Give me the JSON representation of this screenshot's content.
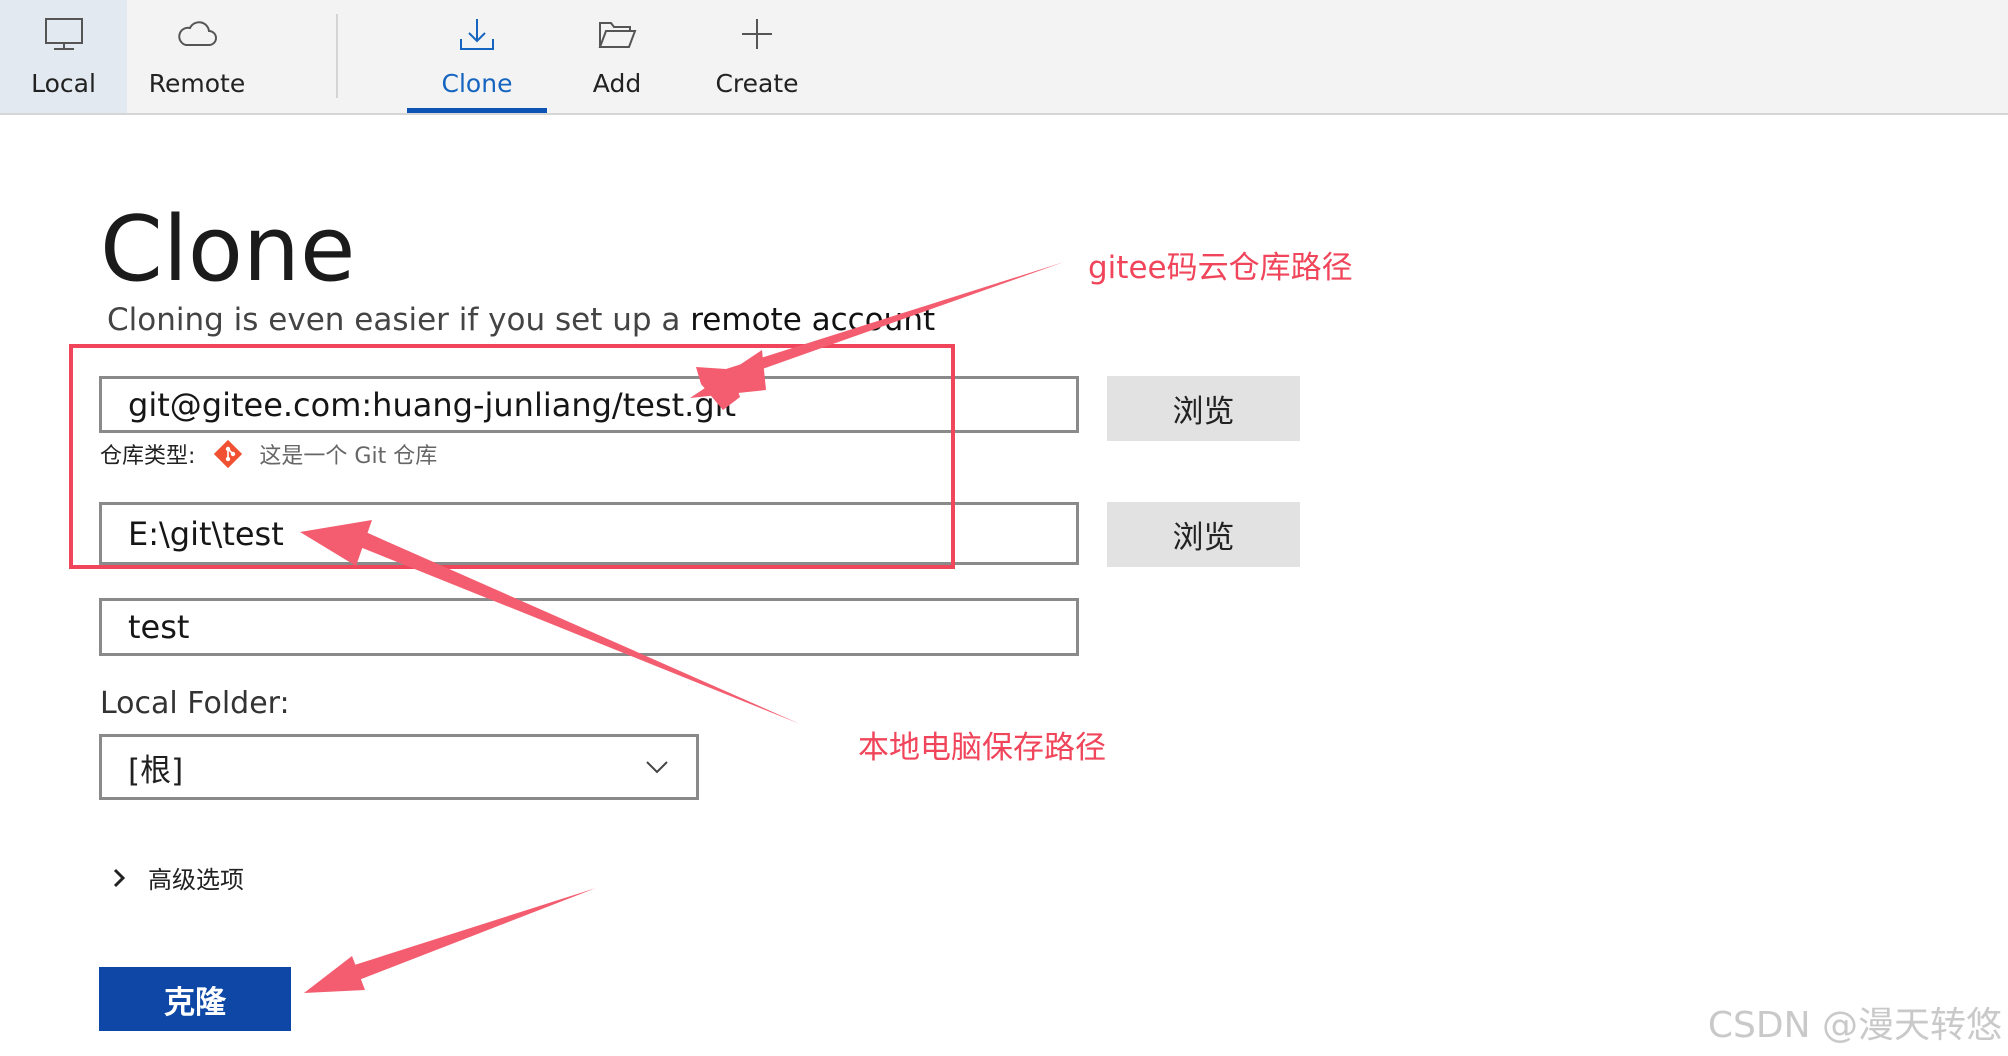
{
  "tabs": {
    "local": "Local",
    "remote": "Remote",
    "clone": "Clone",
    "add": "Add",
    "create": "Create"
  },
  "page": {
    "title": "Clone",
    "subtitle_prefix": "Cloning is even easier if you set up a ",
    "subtitle_link": "remote account"
  },
  "form": {
    "source_url": "git@gitee.com:huang-junliang/test.git",
    "browse_label": "浏览",
    "repo_type_label": "仓库类型:",
    "repo_type_value": "这是一个 Git 仓库",
    "destination_path": "E:\\git\\test",
    "name": "test",
    "local_folder_label": "Local Folder:",
    "local_folder_value": "[根]",
    "advanced_label": "高级选项",
    "clone_button": "克隆"
  },
  "annotations": {
    "remote_note": "gitee码云仓库路径",
    "local_note": "本地电脑保存路径"
  },
  "watermark": "CSDN @漫天转悠",
  "colors": {
    "accent": "#0e47a6",
    "tab_selected_text": "#1565c0",
    "annotation": "#f0455a",
    "tab_bar_bg": "#f3f3f3"
  }
}
